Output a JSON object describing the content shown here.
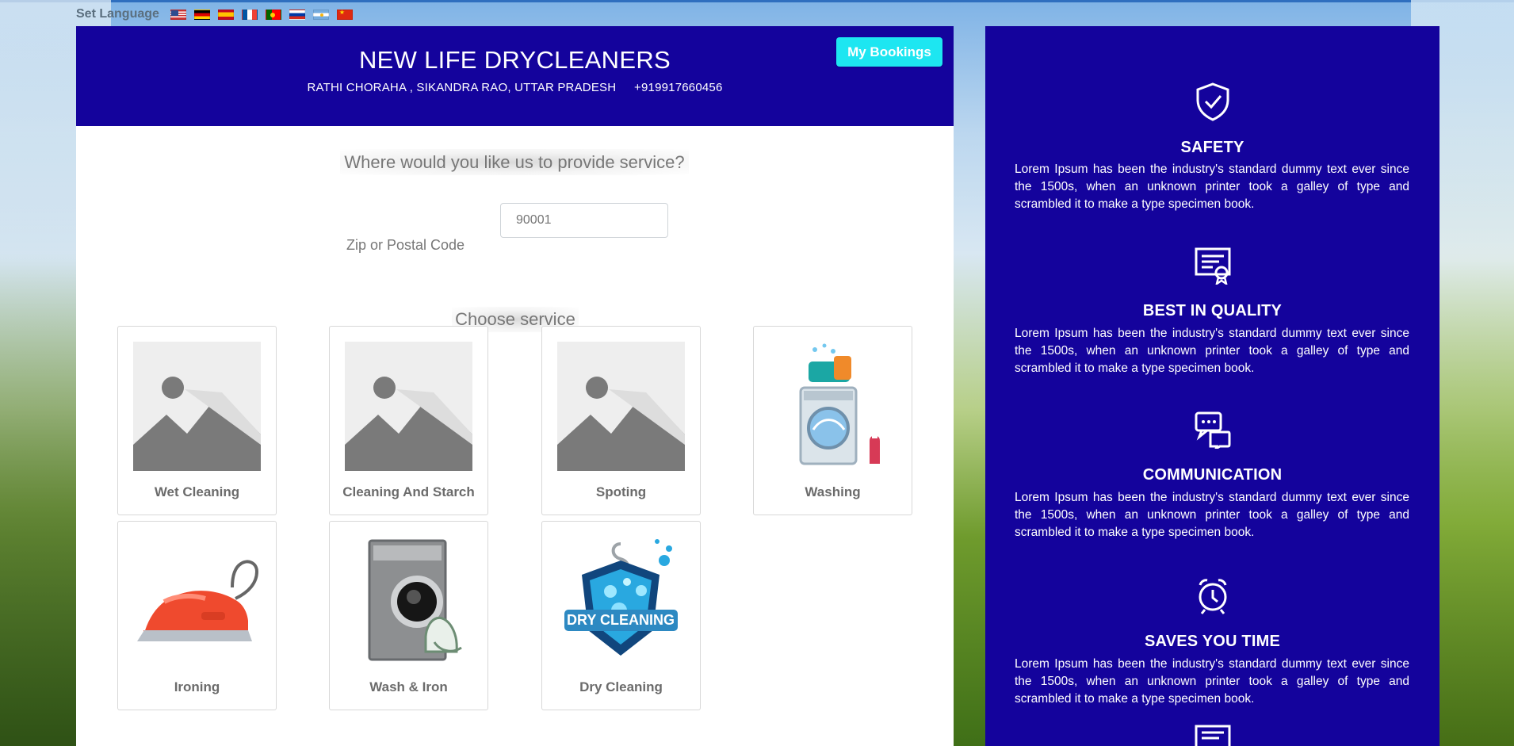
{
  "language_bar": {
    "label": "Set Language",
    "flags": [
      {
        "icon": "us-flag-icon"
      },
      {
        "icon": "germany-flag-icon"
      },
      {
        "icon": "spain-flag-icon"
      },
      {
        "icon": "france-flag-icon"
      },
      {
        "icon": "portugal-flag-icon"
      },
      {
        "icon": "russia-flag-icon"
      },
      {
        "icon": "argentina-flag-icon"
      },
      {
        "icon": "china-flag-icon"
      }
    ]
  },
  "header": {
    "title": "NEW LIFE DRYCLEANERS",
    "address": "RATHI CHORAHA , SIKANDRA RAO, UTTAR PRADESH",
    "phone": "+919917660456",
    "bookings_button": "My Bookings"
  },
  "service_area": {
    "question": "Where would you like us to provide service?",
    "zip_label": "Zip or Postal Code",
    "zip_placeholder": "90001"
  },
  "services": {
    "heading": "Choose service",
    "items": [
      {
        "name": "Wet Cleaning",
        "icon": "image-placeholder-icon"
      },
      {
        "name": "Cleaning And Starch",
        "icon": "image-placeholder-icon"
      },
      {
        "name": "Spoting",
        "icon": "image-placeholder-icon"
      },
      {
        "name": "Washing",
        "icon": "washing-machine-icon"
      },
      {
        "name": "Ironing",
        "icon": "iron-icon"
      },
      {
        "name": "Wash & Iron",
        "icon": "washing-machine-iron-icon"
      },
      {
        "name": "Dry Cleaning",
        "icon": "dry-cleaning-badge-icon"
      }
    ]
  },
  "features": [
    {
      "title": "SAFETY",
      "text": "Lorem Ipsum has been the industry's standard dummy text ever since the 1500s, when an unknown printer took a galley of type and scrambled it to make a type specimen book.",
      "icon": "shield-check-icon"
    },
    {
      "title": "BEST IN QUALITY",
      "text": "Lorem Ipsum has been the industry's standard dummy text ever since the 1500s, when an unknown printer took a galley of type and scrambled it to make a type specimen book.",
      "icon": "certificate-icon"
    },
    {
      "title": "COMMUNICATION",
      "text": "Lorem Ipsum has been the industry's standard dummy text ever since the 1500s, when an unknown printer took a galley of type and scrambled it to make a type specimen book.",
      "icon": "chat-bubbles-icon"
    },
    {
      "title": "SAVES YOU TIME",
      "text": "Lorem Ipsum has been the industry's standard dummy text ever since the 1500s, when an unknown printer took a galley of type and scrambled it to make a type specimen book.",
      "icon": "alarm-clock-icon"
    }
  ],
  "partial_feature": {
    "icon": "document-icon"
  },
  "colors": {
    "brand_blue": "#14039c",
    "accent_cyan": "#1de6f1",
    "text_gray": "#777777"
  }
}
